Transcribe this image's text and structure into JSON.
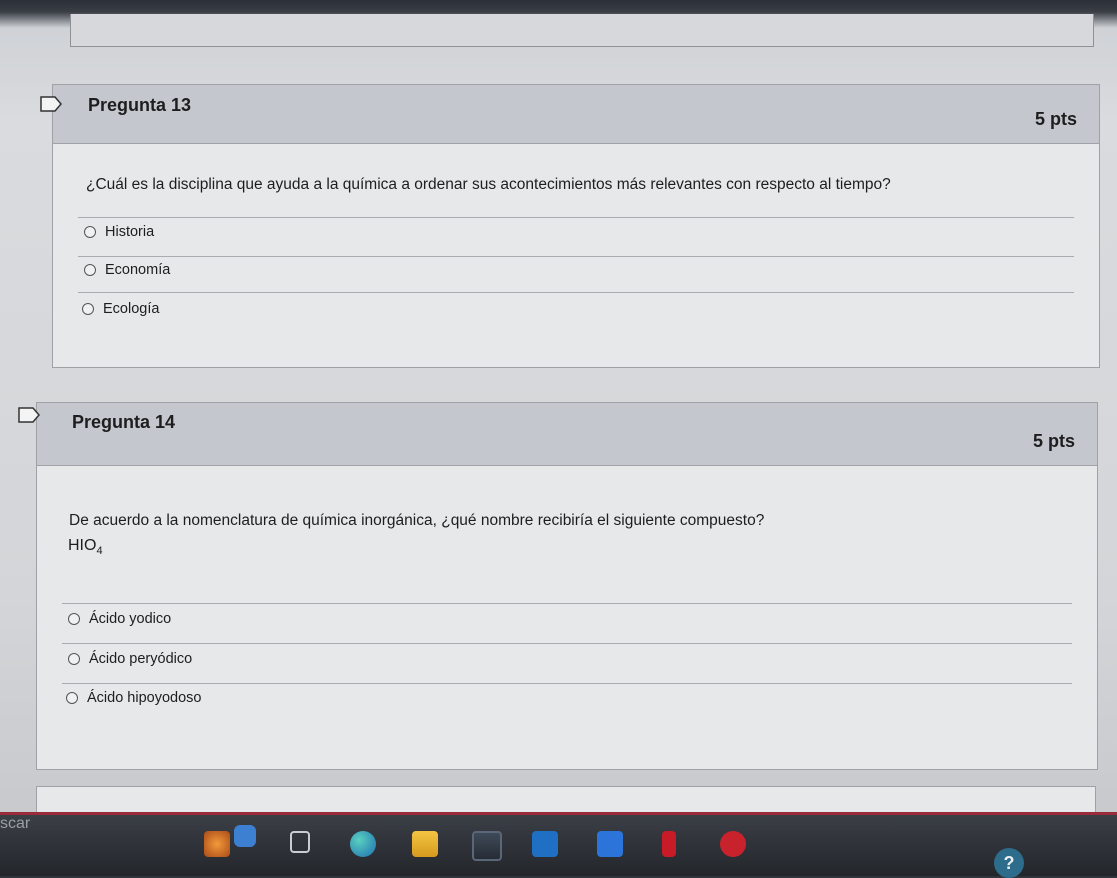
{
  "questions": [
    {
      "title": "Pregunta 13",
      "points": "5 pts",
      "text": "¿Cuál es la disciplina que ayuda a la química a ordenar sus acontecimientos más relevantes con respecto al tiempo?",
      "options": [
        "Historia",
        "Economía",
        "Ecología"
      ]
    },
    {
      "title": "Pregunta 14",
      "points": "5 pts",
      "text": "De acuerdo a la nomenclatura de química inorgánica, ¿qué nombre recibiría el siguiente compuesto?",
      "formula_base": "HIO",
      "formula_sub": "4",
      "options": [
        "Ácido yodico",
        "Ácido peryódico",
        "Ácido hipoyodoso"
      ]
    }
  ],
  "taskbar": {
    "search_hint": "scar",
    "icons": [
      "flower-app-icon",
      "widget-icon",
      "task-view-icon",
      "edge-icon",
      "file-explorer-icon",
      "store-icon",
      "outlook-icon",
      "dropbox-icon",
      "netflix-icon",
      "pinterest-icon"
    ]
  },
  "help_label": "?"
}
